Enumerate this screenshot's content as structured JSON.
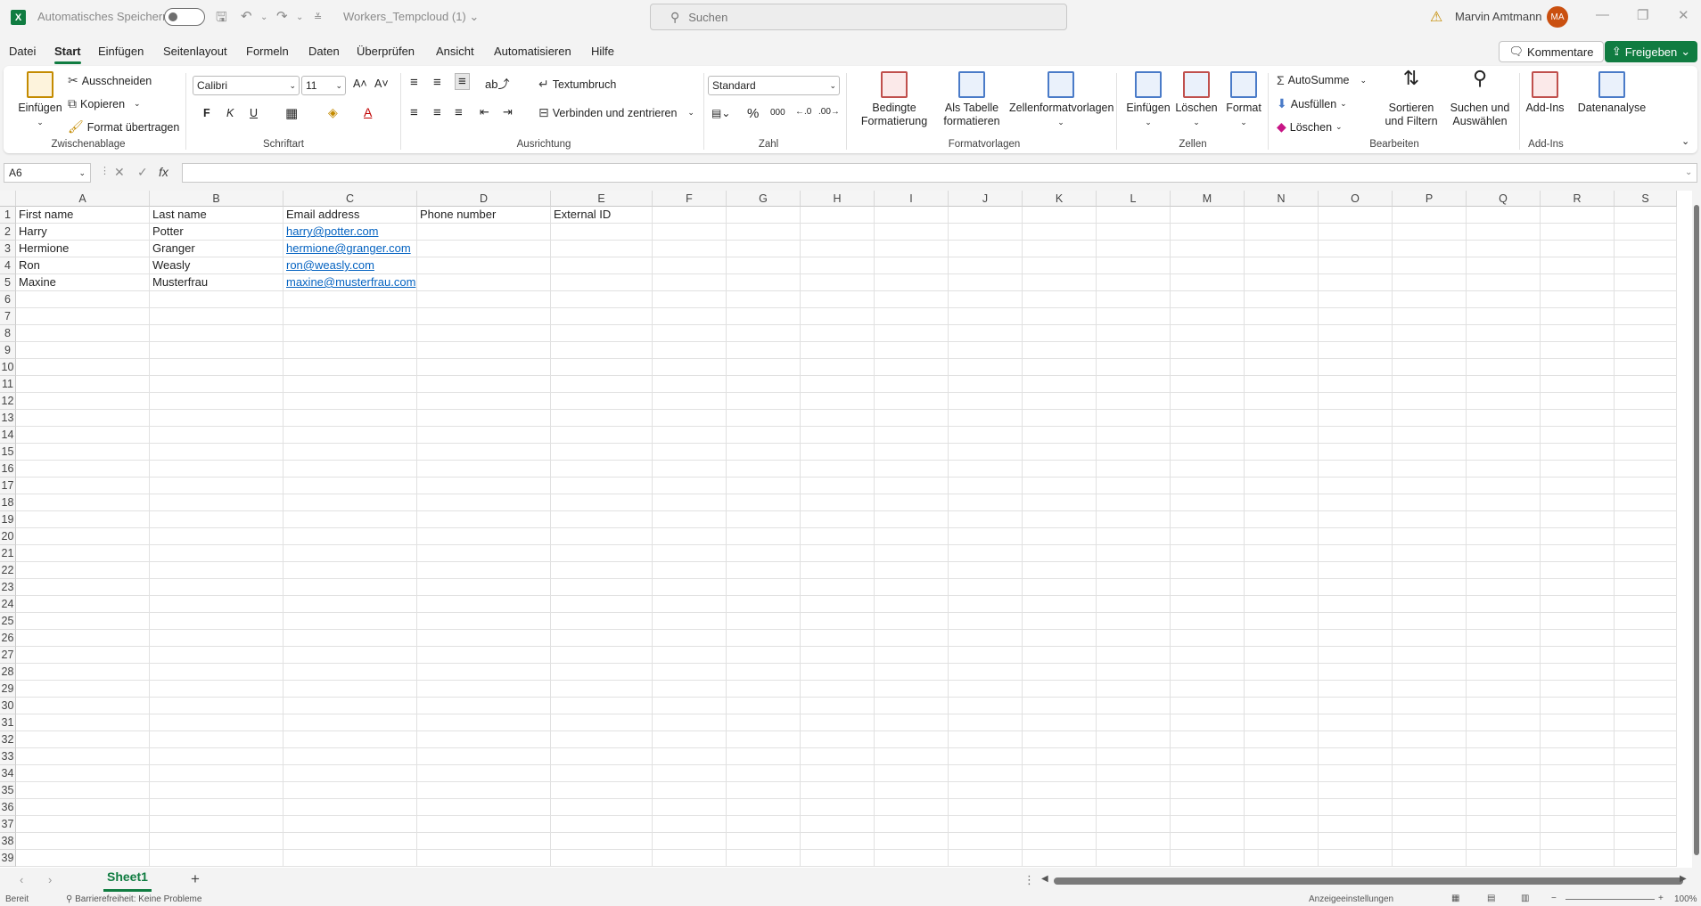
{
  "titlebar": {
    "app_logo": "X",
    "autosave_label": "Automatisches Speichern",
    "doc_title": "Workers_Tempcloud (1)",
    "search_placeholder": "Suchen",
    "user_name": "Marvin Amtmann",
    "user_initials": "MA"
  },
  "menu": {
    "items": [
      "Datei",
      "Start",
      "Einfügen",
      "Seitenlayout",
      "Formeln",
      "Daten",
      "Überprüfen",
      "Ansicht",
      "Automatisieren",
      "Hilfe"
    ],
    "active": "Start",
    "comments_label": "Kommentare",
    "share_label": "Freigeben"
  },
  "ribbon": {
    "clipboard": {
      "paste": "Einfügen",
      "cut": "Ausschneiden",
      "copy": "Kopieren",
      "format_painter": "Format übertragen",
      "label": "Zwischenablage"
    },
    "font": {
      "name": "Calibri",
      "size": "11",
      "bold": "F",
      "italic": "K",
      "underline": "U",
      "label": "Schriftart"
    },
    "alignment": {
      "wrap": "Textumbruch",
      "merge": "Verbinden und zentrieren",
      "label": "Ausrichtung"
    },
    "number": {
      "format": "Standard",
      "label": "Zahl"
    },
    "styles": {
      "conditional": "Bedingte Formatierung",
      "as_table": "Als Tabelle formatieren",
      "cell_styles": "Zellenformatvorlagen",
      "label": "Formatvorlagen"
    },
    "cells": {
      "insert": "Einfügen",
      "delete": "Löschen",
      "format": "Format",
      "label": "Zellen"
    },
    "editing": {
      "autosum": "AutoSumme",
      "fill": "Ausfüllen",
      "clear": "Löschen",
      "sort": "Sortieren und Filtern",
      "find": "Suchen und Auswählen",
      "label": "Bearbeiten"
    },
    "addins": {
      "addins": "Add-Ins",
      "data_analysis": "Datenanalyse",
      "label": "Add-Ins"
    }
  },
  "formula_bar": {
    "name_box": "A6",
    "fx": "fx",
    "formula": ""
  },
  "columns": [
    "A",
    "B",
    "C",
    "D",
    "E",
    "F",
    "G",
    "H",
    "I",
    "J",
    "K",
    "L",
    "M",
    "N",
    "O",
    "P",
    "Q",
    "R",
    "S"
  ],
  "rows": [
    "1",
    "2",
    "3",
    "4",
    "5",
    "6",
    "7",
    "8",
    "9",
    "10",
    "11",
    "12",
    "13",
    "14",
    "15",
    "16",
    "17",
    "18",
    "19",
    "20",
    "21",
    "22",
    "23",
    "24",
    "25",
    "26",
    "27",
    "28",
    "29",
    "30",
    "31",
    "32",
    "33",
    "34",
    "35",
    "36",
    "37",
    "38",
    "39"
  ],
  "cells": [
    [
      "First name",
      "Last name",
      "Email address",
      "Phone number",
      "External ID"
    ],
    [
      "Harry",
      "Potter",
      "harry@potter.com",
      "",
      ""
    ],
    [
      "Hermione",
      "Granger",
      "hermione@granger.com",
      "",
      ""
    ],
    [
      "Ron",
      "Weasly",
      "ron@weasly.com",
      "",
      ""
    ],
    [
      "Maxine",
      "Musterfrau",
      "maxine@musterfrau.com",
      "",
      ""
    ]
  ],
  "sheets": [
    "Sheet1"
  ],
  "status": {
    "ready": "Bereit",
    "accessibility": "Barrierefreiheit: Keine Probleme",
    "display_settings": "Anzeigeeinstellungen",
    "zoom": "100%"
  }
}
